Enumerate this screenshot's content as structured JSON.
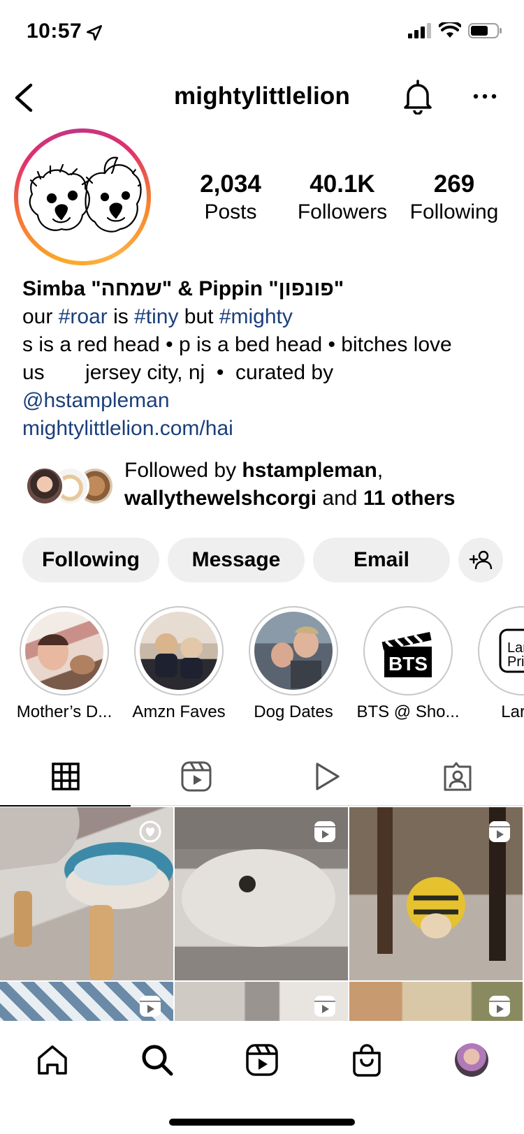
{
  "status_bar": {
    "time": "10:57"
  },
  "header": {
    "username": "mightylittlelion"
  },
  "stats": [
    {
      "value": "2,034",
      "label": "Posts"
    },
    {
      "value": "40.1K",
      "label": "Followers"
    },
    {
      "value": "269",
      "label": "Following"
    }
  ],
  "bio": {
    "name": "Simba \"שמחה\" & Pippin \"פונפון\"",
    "line1_a": "our ",
    "line1_tag1": "#roar",
    "line1_b": " is ",
    "line1_tag2": "#tiny",
    "line1_c": " but ",
    "line1_tag3": "#mighty",
    "line2": "s is a red head • p is a bed head • bitches love",
    "line3": "us       jersey city, nj  •  curated by",
    "mention": "@hstampleman",
    "website": "mightylittlelion.com/hai"
  },
  "followed_by": {
    "prefix": "Followed by ",
    "user1": "hstampleman",
    "comma": ",",
    "user2": "wallythewelshcorgi",
    "and": " and ",
    "others": "11 others"
  },
  "actions": {
    "following": "Following",
    "message": "Message",
    "email": "Email"
  },
  "highlights": [
    {
      "label": "Mother’s D..."
    },
    {
      "label": "Amzn Faves"
    },
    {
      "label": "Dog Dates"
    },
    {
      "label": "BTS @ Sho..."
    },
    {
      "label": "Large"
    }
  ],
  "highlight_texts": {
    "bts": "BTS",
    "large_line1": "Lar",
    "large_line2": "Pri"
  },
  "tabs": [
    "grid-icon",
    "reels-icon",
    "video-icon",
    "tagged-icon"
  ],
  "icons": {
    "back": "back-chevron-icon",
    "bell": "bell-icon",
    "more": "more-horizontal-icon",
    "add_user": "add-person-icon",
    "nav": [
      "home-icon",
      "search-icon",
      "reels-icon",
      "shop-icon",
      "profile-avatar"
    ]
  },
  "colors": {
    "link": "#1a3f7a",
    "button_bg": "#efefef",
    "ring_gradient": [
      "#f9a825",
      "#e1306c",
      "#c13584"
    ]
  }
}
